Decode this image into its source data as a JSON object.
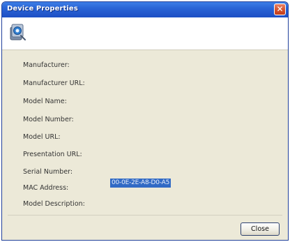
{
  "window": {
    "title": "Device Properties",
    "close_glyph": "✕"
  },
  "icon": {
    "name": "device-icon"
  },
  "properties": [
    {
      "label": "Manufacturer:",
      "value": ""
    },
    {
      "label": "Manufacturer URL:",
      "value": ""
    },
    {
      "label": "Model Name:",
      "value": ""
    },
    {
      "label": "Model Number:",
      "value": ""
    },
    {
      "label": "Model URL:",
      "value": ""
    },
    {
      "label": "Presentation URL:",
      "value": ""
    },
    {
      "label": "Serial Number:",
      "value": ""
    },
    {
      "label": "MAC Address:",
      "value": "00-0E-2E-A8-D0-A5"
    },
    {
      "label": "Model Description:",
      "value": ""
    }
  ],
  "buttons": {
    "close": "Close"
  },
  "colors": {
    "titlebar": "#2a64d6",
    "selection": "#316ac5",
    "dialog_bg": "#ece9d8"
  }
}
